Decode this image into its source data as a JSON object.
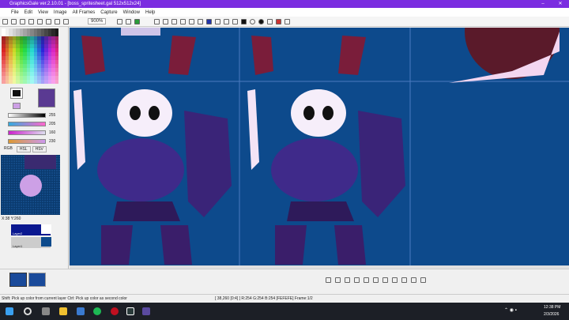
{
  "window": {
    "title": "GraphicsGale ver.2.10.01 - [boss_spritesheet.gal 512x512x24]",
    "min": "–",
    "max": "□",
    "close": "✕"
  },
  "menu": [
    "File",
    "Edit",
    "View",
    "Image",
    "All Frames",
    "Capture",
    "Window",
    "Help"
  ],
  "toolbar": {
    "zoom": "900%"
  },
  "colors": {
    "rgb_values": [
      "205",
      "160",
      "230"
    ],
    "alpha": "255",
    "tabs": [
      "RGB",
      "HSL",
      "HSV"
    ]
  },
  "preview": {
    "coords": "X:38 Y:260"
  },
  "layers": [
    {
      "name": "Layer2"
    },
    {
      "name": "Layer1"
    }
  ],
  "status": {
    "hint": "Shift: Pick up color from current layer  Ctrl: Pick up color as second color",
    "info": "[ 38,260 [0:4] ] R:254 G:254 B:254  [FEFEFE]  Frame:1/2"
  },
  "taskbar": {
    "time": "12:38 PM",
    "date": "2/3/2026"
  }
}
